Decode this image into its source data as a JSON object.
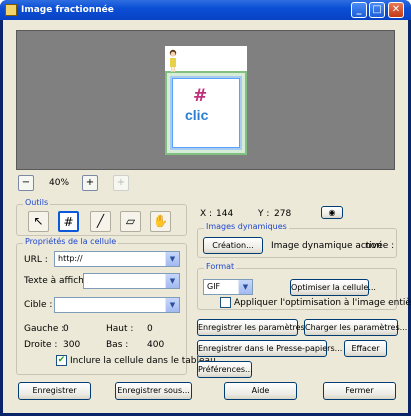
{
  "window": {
    "title": "Image fractionnée"
  },
  "preview": {
    "cell_text": "clic",
    "cell_glyph": "#"
  },
  "zoom": {
    "level": "40%"
  },
  "tools": {
    "legend": "Outils",
    "items": [
      "pointer-tool",
      "slice-tool",
      "pen-tool",
      "eraser-tool",
      "hand-tool"
    ],
    "active": "slice-tool"
  },
  "coords": {
    "x_label": "X :",
    "x_value": "144",
    "y_label": "Y :",
    "y_value": "278"
  },
  "cell_props": {
    "legend": "Propriétés de la cellule",
    "url_label": "URL :",
    "url_value": "http://",
    "text_label": "Texte à afficher :",
    "text_value": "",
    "target_label": "Cible :",
    "target_value": "",
    "left_label": "Gauche :",
    "left_value": "0",
    "top_label": "Haut :",
    "top_value": "0",
    "right_label": "Droite :",
    "right_value": "300",
    "bottom_label": "Bas :",
    "bottom_value": "400",
    "include_label": "Inclure la cellule dans le tableau",
    "include_checked": true
  },
  "dynamic": {
    "legend": "Images dynamiques",
    "create_button": "Création...",
    "status_label": "Image dynamique activée :",
    "status_value": "non"
  },
  "format": {
    "legend": "Format",
    "selected": "GIF",
    "optimize_button": "Optimiser la cellule...",
    "apply_label": "Appliquer l'optimisation à l'image entière",
    "apply_checked": false
  },
  "actions": {
    "save_params": "Enregistrer les paramètres...",
    "load_params": "Charger les paramètres...",
    "save_clipboard": "Enregistrer dans le Presse-papiers...",
    "clear": "Effacer",
    "prefs": "Préférences..."
  },
  "footer": {
    "save": "Enregistrer",
    "save_as": "Enregistrer sous...",
    "help": "Aide",
    "close": "Fermer"
  }
}
